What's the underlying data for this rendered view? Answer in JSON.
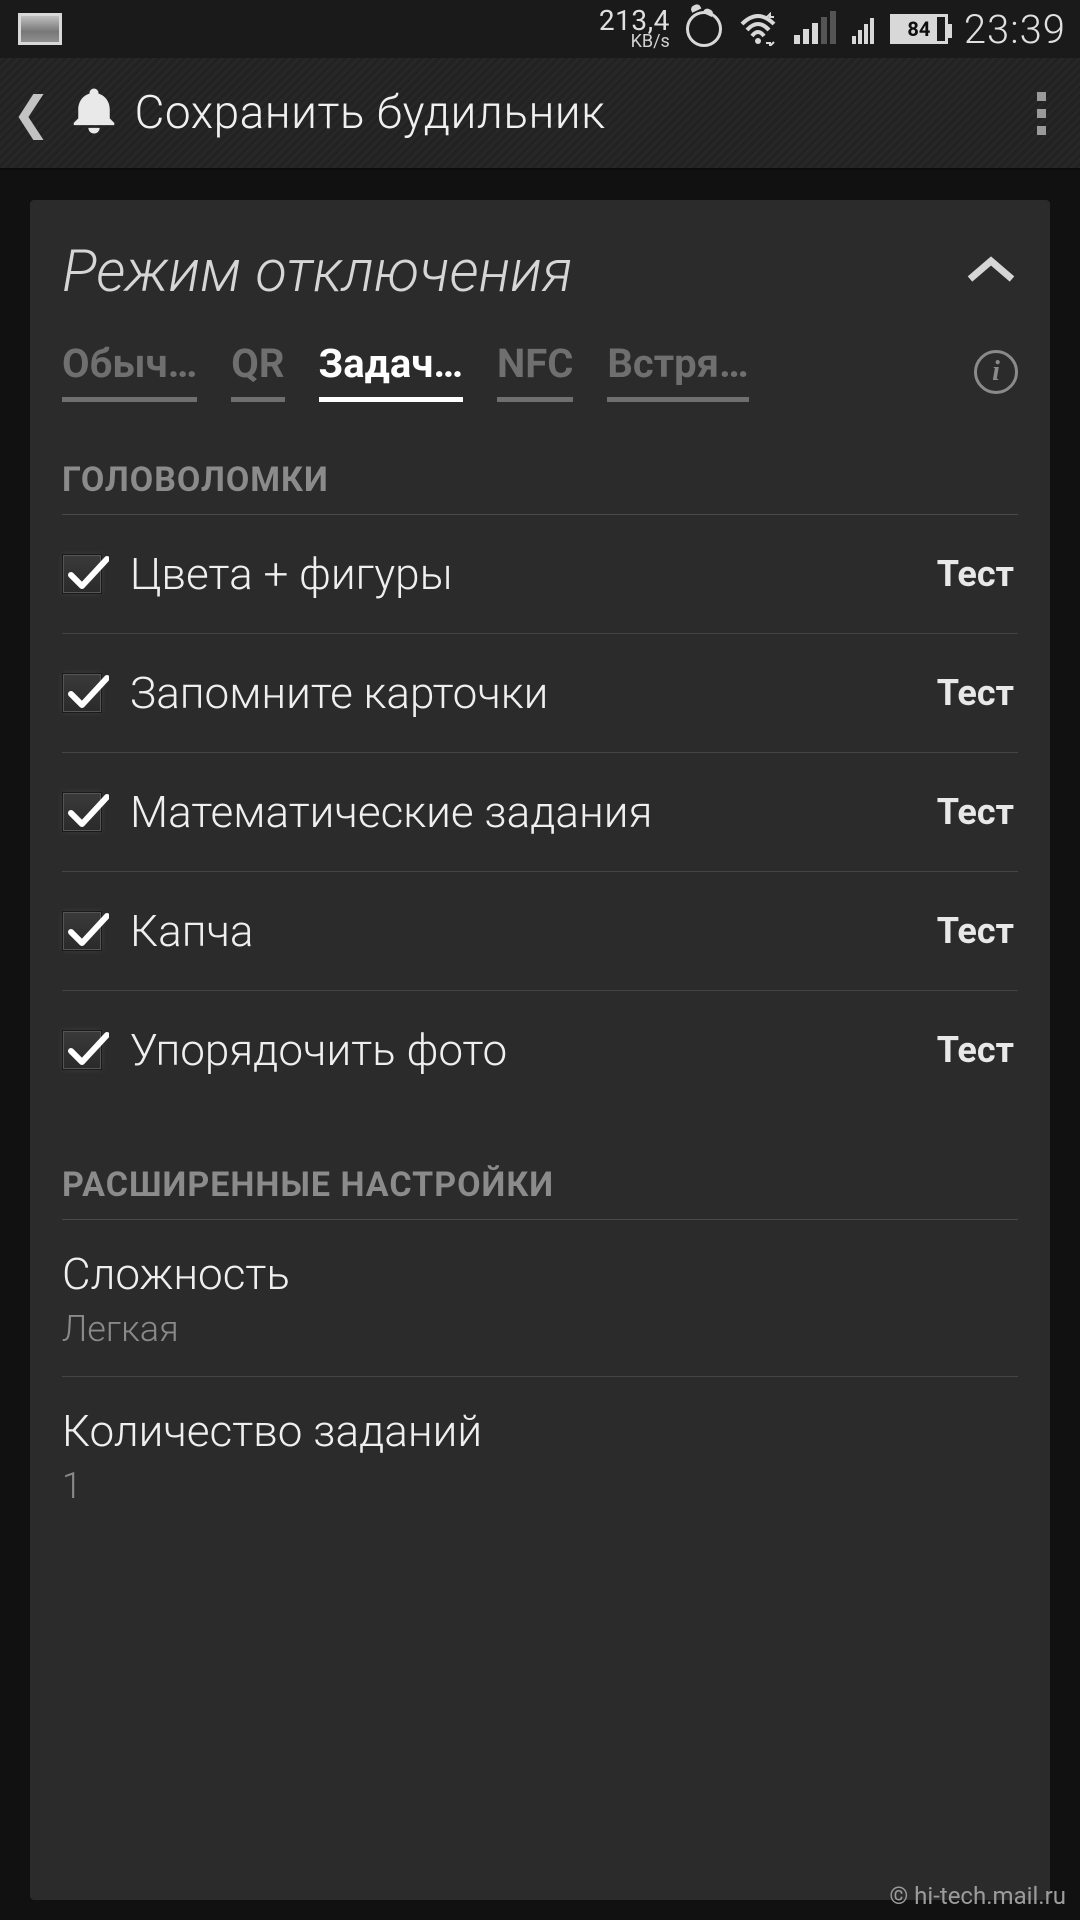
{
  "status": {
    "net_speed_value": "213,4",
    "net_speed_unit": "KB/s",
    "battery_pct": "84",
    "time": "23:39"
  },
  "header": {
    "title": "Сохранить будильник"
  },
  "section": {
    "title": "Режим отключения"
  },
  "tabs": [
    {
      "label": "Обыч…"
    },
    {
      "label": "QR"
    },
    {
      "label": "Задач…"
    },
    {
      "label": "NFC"
    },
    {
      "label": "Встря…"
    }
  ],
  "groups": {
    "puzzles_label": "ГОЛОВОЛОМКИ",
    "advanced_label": "РАСШИРЕННЫЕ НАСТРОЙКИ"
  },
  "test_label": "Тест",
  "puzzles": [
    {
      "label": "Цвета + фигуры"
    },
    {
      "label": "Запомните карточки"
    },
    {
      "label": "Математические задания"
    },
    {
      "label": "Капча"
    },
    {
      "label": "Упорядочить фото"
    }
  ],
  "settings": {
    "difficulty_label": "Сложность",
    "difficulty_value": "Легкая",
    "tasks_count_label": "Количество заданий",
    "tasks_count_value": "1"
  },
  "watermark": "© hi-tech.mail.ru"
}
